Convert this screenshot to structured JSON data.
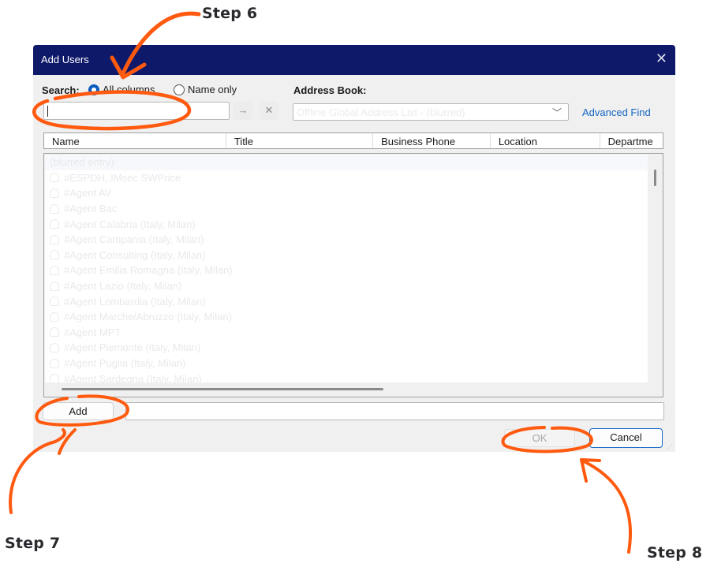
{
  "annotations": {
    "step6": "Step 6",
    "step7": "Step 7",
    "step8": "Step 8",
    "color": "#ff5a0f"
  },
  "dialog": {
    "title": "Add Users",
    "close_icon": "close-icon",
    "search": {
      "label": "Search:",
      "options": [
        "All columns",
        "Name only"
      ],
      "selected": "All columns",
      "value": "",
      "go_icon": "arrow-right-icon",
      "clear_icon": "close-icon"
    },
    "address_book": {
      "label": "Address Book:",
      "value": "Offline Global Address List - (blurred)",
      "advanced_find": "Advanced Find"
    },
    "columns": [
      "Name",
      "Title",
      "Business Phone",
      "Location",
      "Departme"
    ],
    "list": [
      "(blurred entry)",
      "#ESPDH, IMsec SWPrice",
      "#Agent AV",
      "#Agent Bac",
      "#Agent Calabria (Italy, Milan)",
      "#Agent Campania (Italy, Milan)",
      "#Agent Consulting (Italy, Milan)",
      "#Agent Emilia Romagna (Italy, Milan)",
      "#Agent Lazio (Italy, Milan)",
      "#Agent Lombardia (Italy, Milan)",
      "#Agent Marche/Abruzzo (Italy, Milan)",
      "#Agent MPT",
      "#Agent Piemonte (Italy, Milan)",
      "#Agent Puglia (Italy, Milan)",
      "#Agent Sardegna (Italy, Milan)"
    ],
    "add_button": "Add",
    "add_field_value": "",
    "ok_button": "OK",
    "cancel_button": "Cancel",
    "accent": "#0e1a69",
    "link_color": "#1565c0"
  }
}
